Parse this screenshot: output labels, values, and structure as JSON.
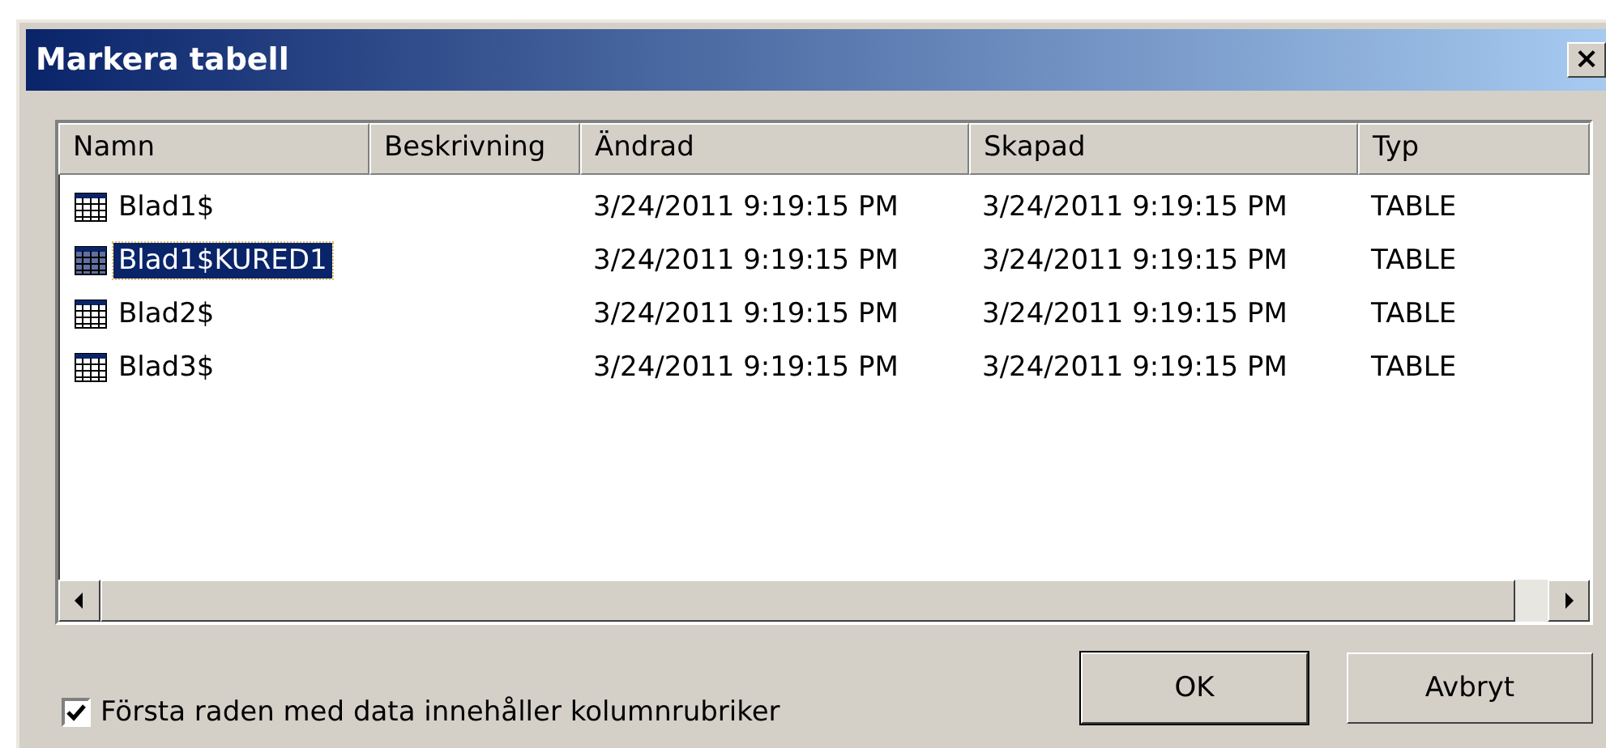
{
  "window": {
    "title": "Markera tabell",
    "close": "×"
  },
  "table": {
    "columns": [
      "Namn",
      "Beskrivning",
      "Ändrad",
      "Skapad",
      "Typ"
    ],
    "rows": [
      {
        "name": "Blad1$",
        "modified": "3/24/2011 9:19:15 PM",
        "created": "3/24/2011 9:19:15 PM",
        "type": "TABLE",
        "selected": false
      },
      {
        "name": "Blad1$KURED1",
        "modified": "3/24/2011 9:19:15 PM",
        "created": "3/24/2011 9:19:15 PM",
        "type": "TABLE",
        "selected": true
      },
      {
        "name": "Blad2$",
        "modified": "3/24/2011 9:19:15 PM",
        "created": "3/24/2011 9:19:15 PM",
        "type": "TABLE",
        "selected": false
      },
      {
        "name": "Blad3$",
        "modified": "3/24/2011 9:19:15 PM",
        "created": "3/24/2011 9:19:15 PM",
        "type": "TABLE",
        "selected": false
      }
    ]
  },
  "header_row_checkbox": {
    "label": "Första raden med data innehåller kolumnrubriker",
    "checked": true
  },
  "buttons": [
    "OK",
    "Avbryt"
  ]
}
